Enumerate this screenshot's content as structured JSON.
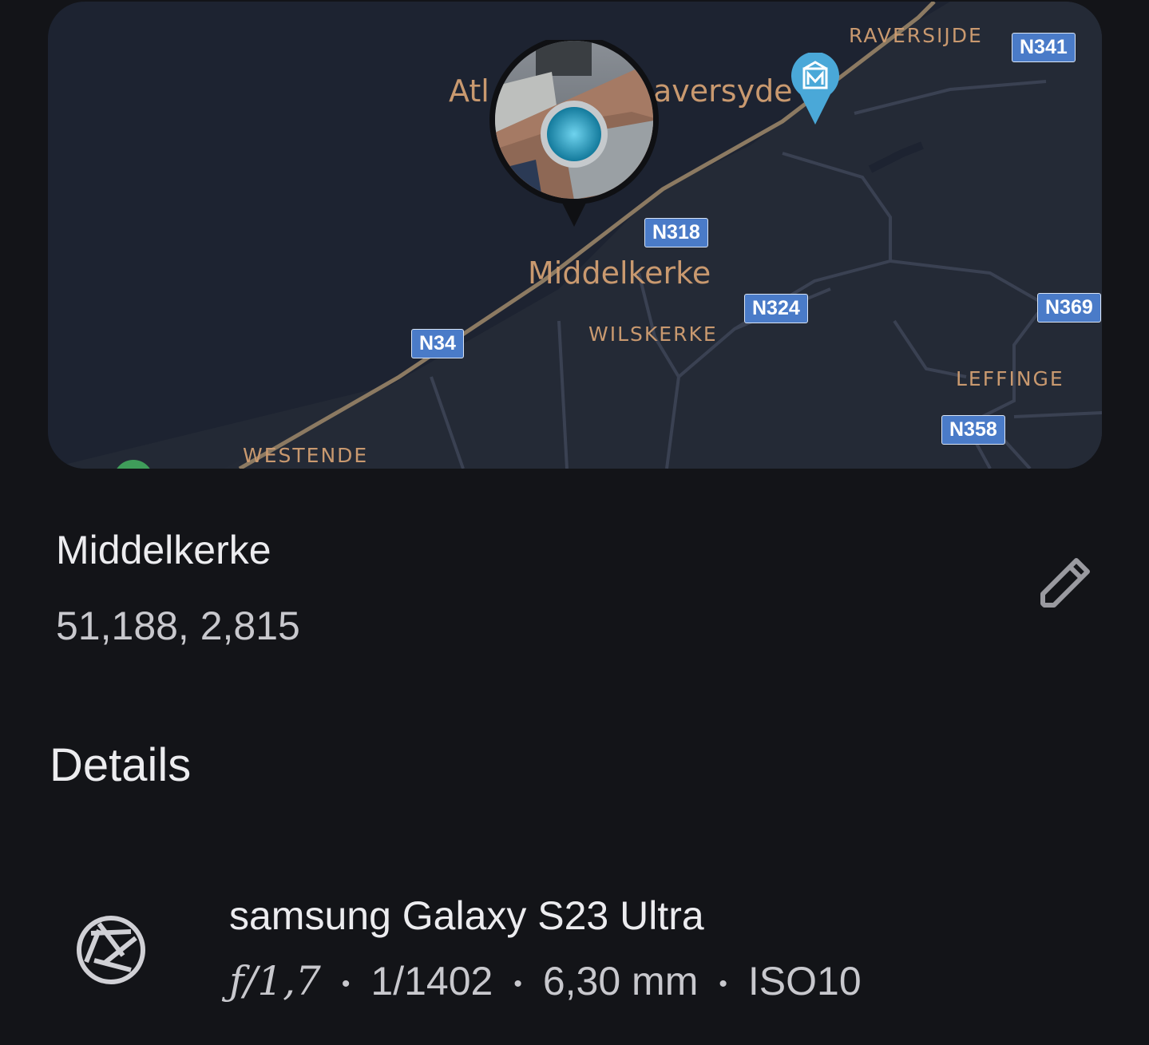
{
  "map": {
    "places": {
      "raversijde": "RAVERSIJDE",
      "atlantic_left": "Atl",
      "atlantic_right": "aversyde",
      "middelkerke": "Middelkerke",
      "wilskerke": "WILSKERKE",
      "leffinge": "LEFFINGE",
      "westende": "WESTENDE"
    },
    "roads": {
      "n341": "N341",
      "n318": "N318",
      "n324": "N324",
      "n369": "N369",
      "n34": "N34",
      "n358": "N358"
    },
    "colors": {
      "sea": "#1d2331",
      "land": "#232935",
      "road_label": "#4a7bc8",
      "place_label": "#c9996f",
      "pin": "#4aa8d8"
    }
  },
  "location": {
    "name": "Middelkerke",
    "coordinates": "51,188, 2,815",
    "edit_icon": "pencil-icon"
  },
  "details": {
    "heading": "Details",
    "camera": {
      "icon": "aperture-icon",
      "model": "samsung Galaxy S23 Ultra",
      "aperture": "ƒ/1,7",
      "shutter": "1/1402",
      "focal_length": "6,30 mm",
      "iso": "ISO10",
      "separator": "•"
    }
  }
}
